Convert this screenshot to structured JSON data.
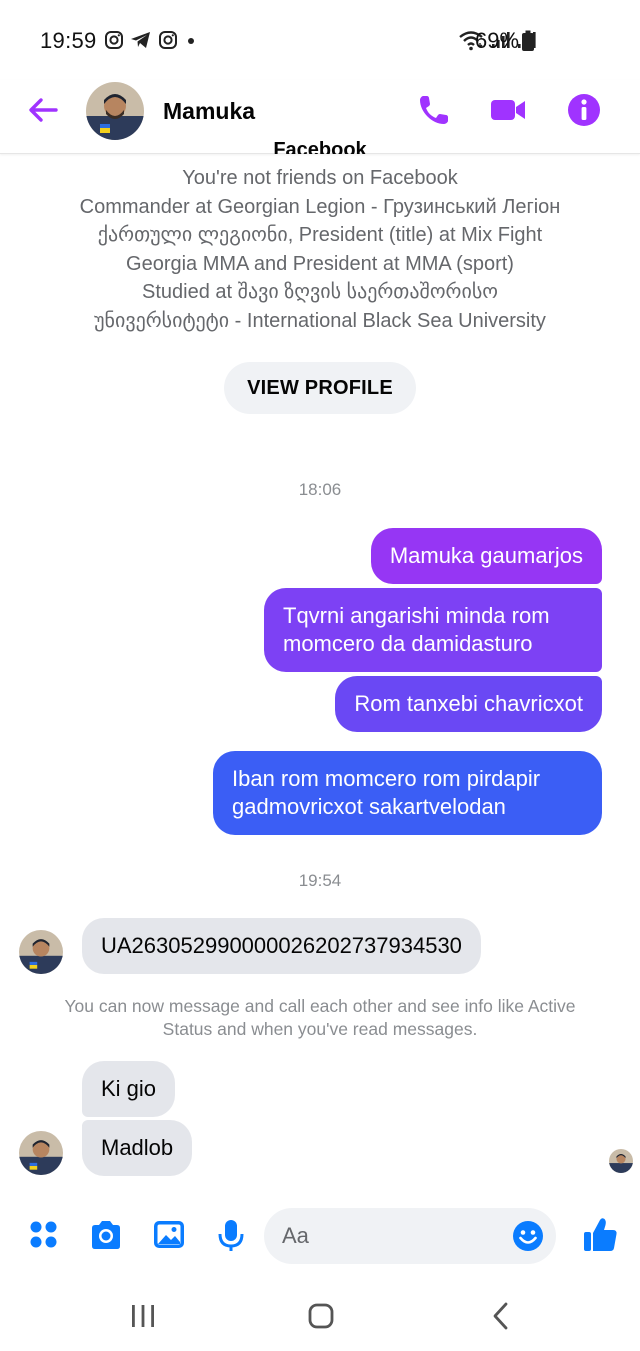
{
  "status_bar": {
    "time": "19:59",
    "battery": "69%"
  },
  "header": {
    "contact_name": "Mamuka"
  },
  "profile": {
    "cut_line": "Facebook",
    "lines": [
      "You're not friends on Facebook",
      "Commander at Georgian Legion - Грузинський Легіон",
      "ქართული ლეგიონი, President (title) at Mix Fight",
      "Georgia MMA and President at MMA (sport)",
      "Studied at შავი ზღვის საერთაშორისო",
      "უნივერსიტეტი - International Black Sea University"
    ],
    "view_profile_label": "VIEW PROFILE"
  },
  "conversation": {
    "timestamp_1": "18:06",
    "outgoing": [
      "Mamuka gaumarjos",
      "Tqvrni angarishi minda rom momcero da damidasturo",
      "Rom tanxebi chavricxot",
      "Iban rom momcero rom pirdapir gadmovricxot sakartvelodan"
    ],
    "timestamp_2": "19:54",
    "incoming_iban": "UA263052990000026202737934530",
    "system_note": "You can now message and call each other and see info like Active Status and when you've read messages.",
    "incoming": [
      "Ki  gio",
      "Madlob"
    ]
  },
  "composer": {
    "placeholder": "Aa"
  },
  "colors": {
    "accent": "#a033ff",
    "messenger_blue": "#0a7cff",
    "bubble_gradient_top": "#9b35f6",
    "bubble_gradient_bottom": "#3a5cf5",
    "incoming_bubble": "#e4e6eb"
  }
}
